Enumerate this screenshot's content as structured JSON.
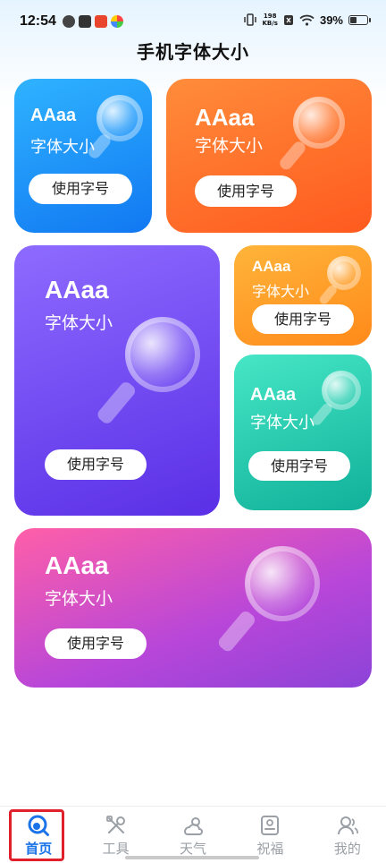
{
  "status_bar": {
    "time": "12:54",
    "net_speed_value": "198",
    "net_speed_unit": "KB/s",
    "battery_percent": "39%",
    "battery_level": 0.39
  },
  "header": {
    "title": "手机字体大小"
  },
  "cards": [
    {
      "sample_text": "AAaa",
      "label": "字体大小",
      "button": "使用字号",
      "color": "#1c8ff5"
    },
    {
      "sample_text": "AAaa",
      "label": "字体大小",
      "button": "使用字号",
      "color": "#ff6d28"
    },
    {
      "sample_text": "AAaa",
      "label": "字体大小",
      "button": "使用字号",
      "color": "#6f45f2"
    },
    {
      "sample_text": "AAaa",
      "label": "字体大小",
      "button": "使用字号",
      "color": "#ff9d28"
    },
    {
      "sample_text": "AAaa",
      "label": "字体大小",
      "button": "使用字号",
      "color": "#22c9ad"
    },
    {
      "sample_text": "AAaa",
      "label": "字体大小",
      "button": "使用字号",
      "color": "#d04bbb"
    }
  ],
  "bottom_nav": {
    "items": [
      {
        "label": "首页",
        "icon": "home-search-icon",
        "active": true
      },
      {
        "label": "工具",
        "icon": "tools-icon",
        "active": false
      },
      {
        "label": "天气",
        "icon": "weather-icon",
        "active": false
      },
      {
        "label": "祝福",
        "icon": "greeting-card-icon",
        "active": false
      },
      {
        "label": "我的",
        "icon": "profile-icon",
        "active": false
      }
    ]
  }
}
